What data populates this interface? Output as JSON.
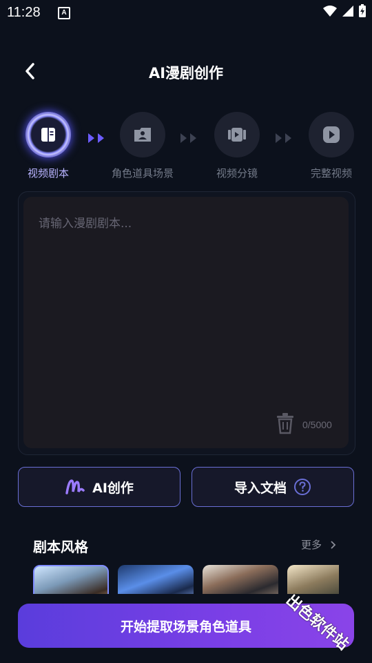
{
  "status": {
    "time": "11:28",
    "a_badge": "A"
  },
  "header": {
    "title": "AI漫剧创作"
  },
  "steps": [
    {
      "label": "视频剧本",
      "icon": "book-icon",
      "active": true
    },
    {
      "label": "角色道具场景",
      "icon": "person-card-icon",
      "active": false
    },
    {
      "label": "视频分镜",
      "icon": "storyboard-icon",
      "active": false
    },
    {
      "label": "完整视频",
      "icon": "play-icon",
      "active": false
    }
  ],
  "editor": {
    "placeholder": "请输入漫剧剧本...",
    "count": "0/5000"
  },
  "buttons": {
    "ai_create": "AI创作",
    "import_doc": "导入文档"
  },
  "style_section": {
    "title": "剧本风格",
    "more": "更多"
  },
  "cta": {
    "label": "开始提取场景角色道具"
  },
  "watermark": "出色软件站",
  "colors": {
    "accent": "#7f8cff",
    "cta_start": "#5a3ddc",
    "cta_end": "#8a44e8",
    "bg": "#0c111c"
  }
}
